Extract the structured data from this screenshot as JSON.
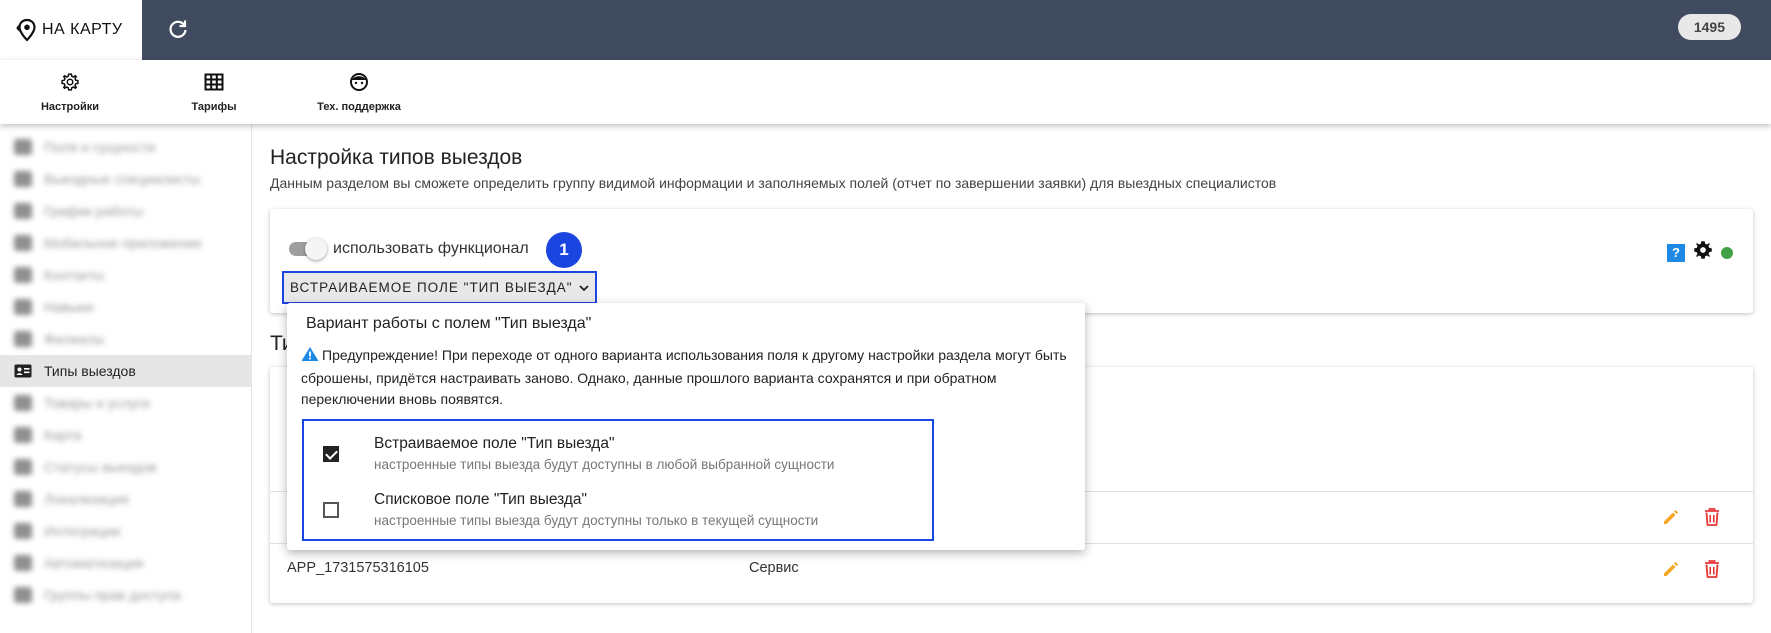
{
  "header": {
    "logo_text": "НА КАРТУ",
    "counter": "1495"
  },
  "toolbar": {
    "items": [
      {
        "label": "Настройки",
        "icon": "gear-icon"
      },
      {
        "label": "Тарифы",
        "icon": "table-icon"
      },
      {
        "label": "Тех. поддержка",
        "icon": "support-icon"
      }
    ]
  },
  "sidebar": {
    "items": [
      {
        "label": "Поля и сущности",
        "active": false
      },
      {
        "label": "Выездные специалисты",
        "active": false
      },
      {
        "label": "График работы",
        "active": false
      },
      {
        "label": "Мобильное приложение",
        "active": false
      },
      {
        "label": "Контакты",
        "active": false
      },
      {
        "label": "Навыки",
        "active": false
      },
      {
        "label": "Филиалы",
        "active": false
      },
      {
        "label": "Типы выездов",
        "active": true
      },
      {
        "label": "Товары и услуги",
        "active": false
      },
      {
        "label": "Карта",
        "active": false
      },
      {
        "label": "Статусы выездов",
        "active": false
      },
      {
        "label": "Локализация",
        "active": false
      },
      {
        "label": "Интеграции",
        "active": false
      },
      {
        "label": "Автоматизация",
        "active": false
      },
      {
        "label": "Группы прав доступа",
        "active": false
      }
    ]
  },
  "main": {
    "title": "Настройка типов выездов",
    "subtitle": "Данным разделом вы сможете определить группу видимой информации и заполняемых полей (отчет по завершении заявки) для выездных специалистов",
    "toggle_label": "использовать функционал",
    "step_badge": "1",
    "help_label": "?",
    "select_label": "ВСТРАИВАЕМОЕ ПОЛЕ \"ТИП ВЫЕЗДА\"",
    "section2_heading": "Ти",
    "rows": [
      {
        "id": "",
        "type": ""
      },
      {
        "id": "APP_1731575316105",
        "type": "Сервис"
      }
    ]
  },
  "popup": {
    "title": "Вариант работы с полем \"Тип выезда\"",
    "warning": "Предупреждение! При переходе от одного варианта использования поля к другому настройки раздела могут быть сброшены, придётся настраивать заново. Однако, данные прошлого варианта сохранятся и при обратном переключении вновь появятся.",
    "options": [
      {
        "title": "Встраиваемое поле \"Тип выезда\"",
        "subtitle": "настроенные типы выезда будут доступны в любой выбранной сущности",
        "checked": true
      },
      {
        "title": "Списковое поле \"Тип выезда\"",
        "subtitle": "настроенные типы выезда будут доступны только в текущей сущности",
        "checked": false
      }
    ]
  },
  "colors": {
    "topbar": "#414b5f",
    "accent_blue": "#1a45e0",
    "status_green": "#43a047",
    "edit_orange": "#f5a623",
    "delete_red": "#e53935"
  }
}
